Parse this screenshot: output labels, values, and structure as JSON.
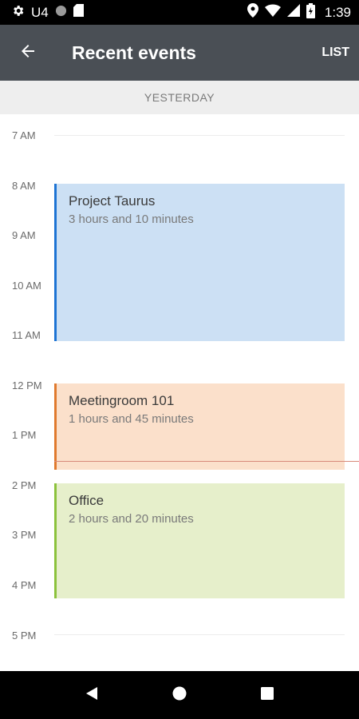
{
  "status_bar": {
    "time": "1:39",
    "carrier_indicator": "U4",
    "icons_left": [
      "gear-icon",
      "circle-icon",
      "sd-card-icon"
    ],
    "icons_right": [
      "location-icon",
      "wifi-icon",
      "signal-icon",
      "battery-charging-icon"
    ]
  },
  "app_bar": {
    "title": "Recent events",
    "action_label": "LIST",
    "back_icon": "arrow-left-icon"
  },
  "day_header": "YESTERDAY",
  "hours": [
    "7 AM",
    "8 AM",
    "9 AM",
    "10 AM",
    "11 AM",
    "12 PM",
    "1 PM",
    "2 PM",
    "3 PM",
    "4 PM",
    "5 PM"
  ],
  "events": [
    {
      "title": "Project Taurus",
      "duration": "3 hours and 10 minutes",
      "color": "#cce0f4",
      "accent": "#1e74d4"
    },
    {
      "title": "Meetingroom 101",
      "duration": "1 hours and 45 minutes",
      "color": "#fbe0cb",
      "accent": "#e07a2e"
    },
    {
      "title": "Office",
      "duration": "2 hours and 20 minutes",
      "color": "#e6efcb",
      "accent": "#8cc23c"
    }
  ],
  "nav_bar": {
    "icons": [
      "back-triangle-icon",
      "home-circle-icon",
      "recents-square-icon"
    ]
  }
}
